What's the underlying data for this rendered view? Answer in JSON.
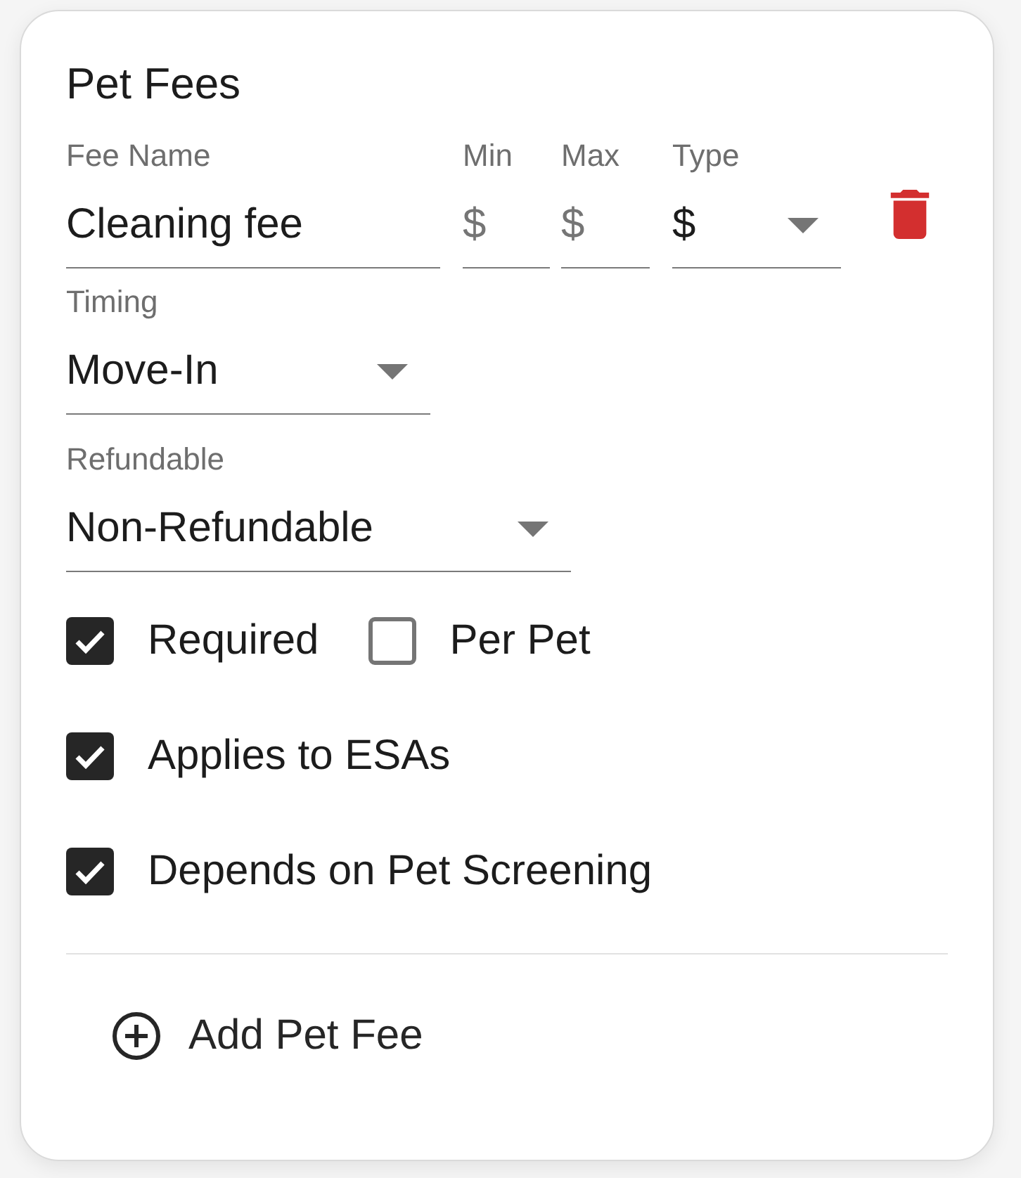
{
  "card": {
    "title": "Pet Fees"
  },
  "fee_fields": [
    {
      "kind": "text",
      "label": "Fee Name",
      "value": "Cleaning fee"
    },
    {
      "kind": "amount",
      "label": "Min",
      "prefix": "$"
    },
    {
      "kind": "amount",
      "label": "Max",
      "prefix": "$"
    },
    {
      "kind": "select",
      "label": "Type",
      "value": "$"
    }
  ],
  "selects": [
    {
      "label": "Timing",
      "value": "Move-In"
    },
    {
      "label": "Refundable",
      "value": "Non-Refundable"
    }
  ],
  "checkbox_rows": [
    {
      "items": [
        {
          "label": "Required",
          "checked": true
        },
        {
          "label": "Per Pet",
          "checked": false
        }
      ]
    },
    {
      "items": [
        {
          "label": "Applies to ESAs",
          "checked": true
        }
      ]
    },
    {
      "items": [
        {
          "label": "Depends on Pet Screening",
          "checked": true
        }
      ]
    }
  ],
  "add_button": {
    "label": "Add Pet Fee"
  }
}
